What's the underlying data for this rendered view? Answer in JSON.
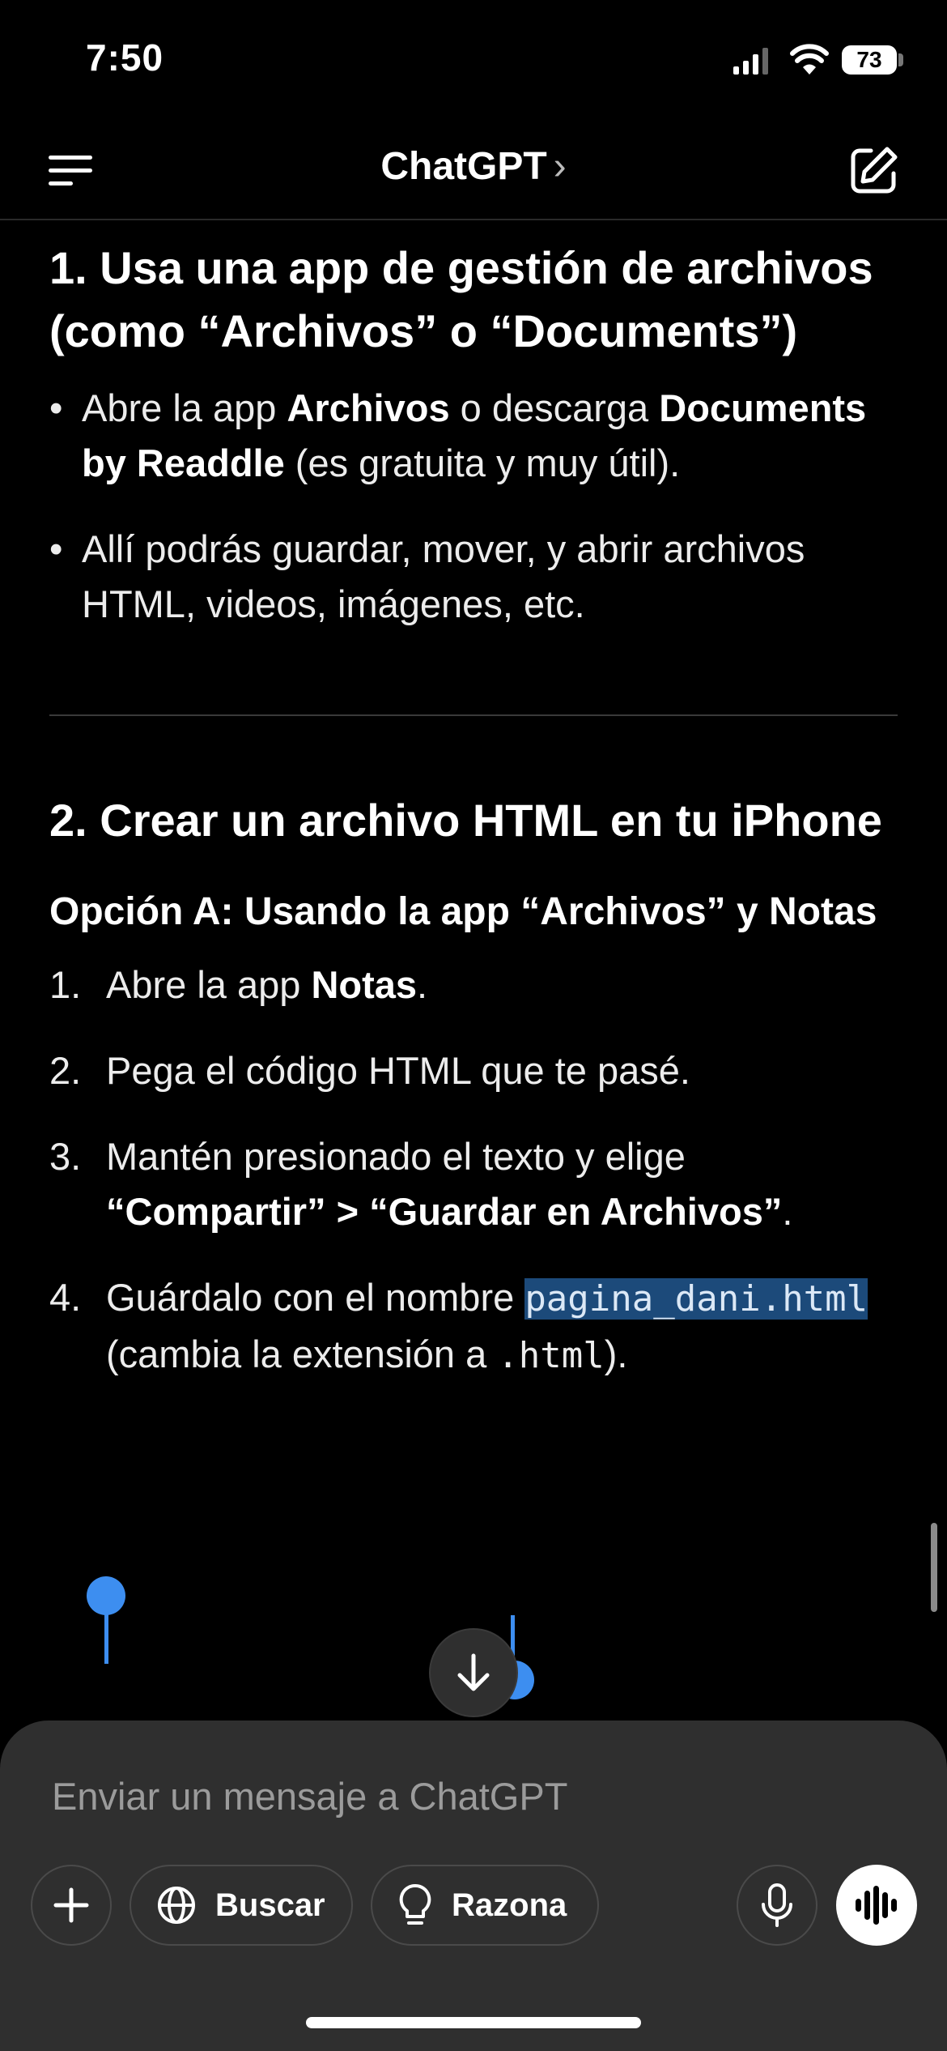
{
  "status_bar": {
    "time": "7:50",
    "battery": "73"
  },
  "navbar": {
    "title": "ChatGPT",
    "chevron": "›"
  },
  "section1": {
    "heading": "1. Usa una app de gestión de archivos (como “Archivos” o “Documents”)",
    "bullet1": {
      "t1": "Abre la app ",
      "b1": "Archivos",
      "t2": " o descarga ",
      "b2": "Documents by Readdle",
      "t3": " (es gratuita y muy útil)."
    },
    "bullet2": "Allí podrás guardar, mover, y abrir archivos HTML, videos, imágenes, etc."
  },
  "section2": {
    "heading": "2. Crear un archivo HTML en tu iPhone",
    "option_a": "Opción A: Usando la app “Archivos” y Notas",
    "step1": {
      "num": "1.",
      "t1": "Abre la app ",
      "b1": "Notas",
      "t2": "."
    },
    "step2": {
      "num": "2.",
      "text": "Pega el código HTML que te pasé."
    },
    "step3": {
      "num": "3.",
      "t1": "Mantén presionado el texto y elige ",
      "b1": "“Compartir” > “Guardar en Archivos”",
      "t2": "."
    },
    "step4": {
      "num": "4.",
      "t1": "Guárdalo con el nombre ",
      "code1": "pagina_dani.html",
      "t2": " (cambia la extensión a ",
      "code2": ".html",
      "t3": ")."
    }
  },
  "composer": {
    "placeholder": "Enviar un mensaje a ChatGPT",
    "search_label": "Buscar",
    "reason_label": "Razona"
  },
  "icons": {
    "menu": "menu-icon",
    "compose": "compose-icon",
    "scroll_down": "arrow-down-icon",
    "plus": "plus-icon",
    "globe": "globe-icon",
    "bulb": "lightbulb-icon",
    "mic": "microphone-icon",
    "voice": "voice-waveform-icon"
  },
  "colors": {
    "background": "#000000",
    "selection": "#1c4a7a",
    "handle": "#3d8ef0",
    "composer": "#2f2f2f"
  }
}
